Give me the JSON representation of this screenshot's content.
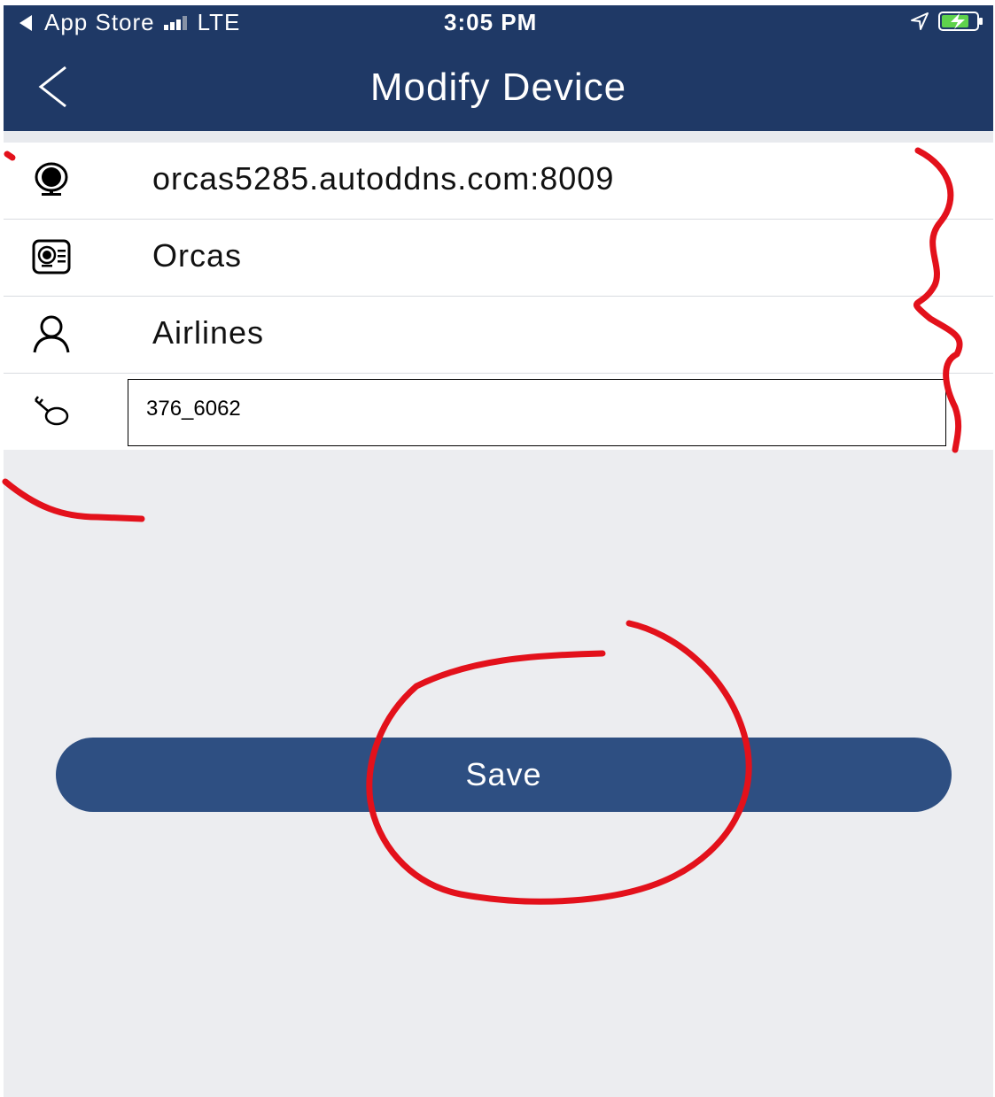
{
  "status_bar": {
    "back_app": "App Store",
    "carrier": "LTE",
    "time": "3:05 PM"
  },
  "nav": {
    "title": "Modify Device"
  },
  "fields": {
    "address": "orcas5285.autoddns.com:8009",
    "device_name": "Orcas",
    "username": "Airlines",
    "password": "376_6062"
  },
  "actions": {
    "save_label": "Save"
  },
  "icons": {
    "back": "chevron-left-icon",
    "address": "webcam-icon",
    "device_name": "device-card-icon",
    "username": "user-icon",
    "password": "key-icon",
    "location": "location-arrow-icon",
    "battery": "battery-charging-icon"
  },
  "colors": {
    "header": "#1f3966",
    "button": "#2e4f82",
    "background": "#ecedf0",
    "annotation": "#e3111b"
  }
}
